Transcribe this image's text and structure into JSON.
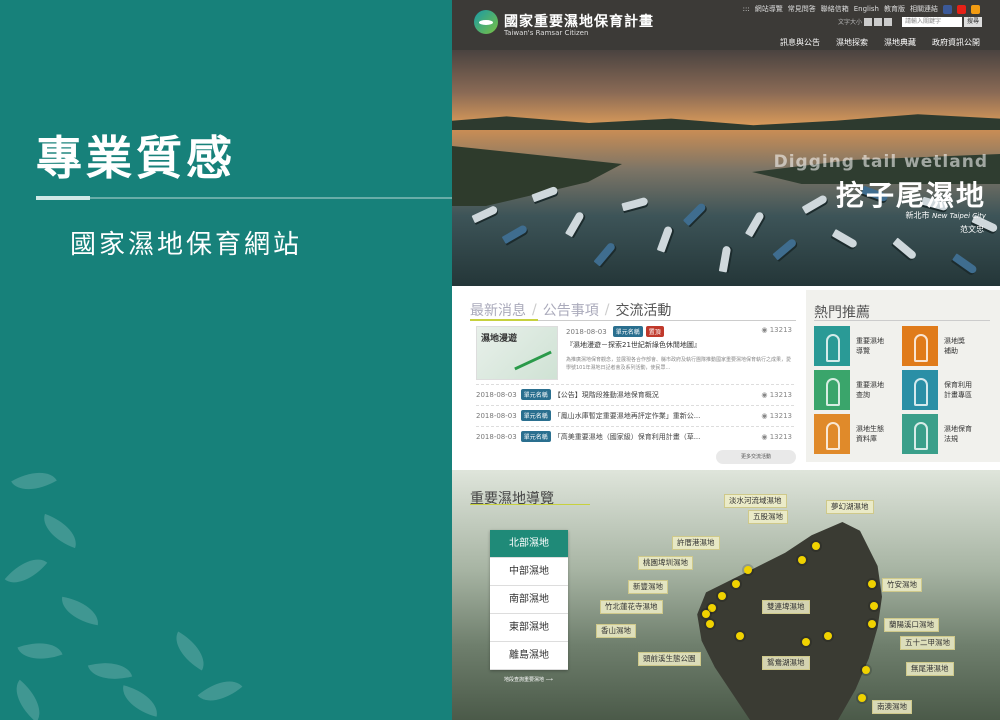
{
  "left": {
    "title": "專業質感",
    "subtitle": "國家濕地保育網站"
  },
  "header": {
    "site_title": "國家重要濕地保育計畫",
    "site_subtitle": "Taiwan's Ramsar Citizen",
    "util_links": [
      "::: ",
      "網站導覽",
      "常見問答",
      "聯絡信箱",
      "English",
      "教育版",
      "相關連結"
    ],
    "font_size_label": "文字大小",
    "font_size_options": [
      "小",
      "中",
      "大"
    ],
    "search_placeholder": "請輸入關鍵字",
    "search_button": "搜尋",
    "nav": [
      "訊息與公告",
      "濕地探索",
      "濕地典藏",
      "政府資訊公開"
    ]
  },
  "hero": {
    "en_title": "Digging tail wetland",
    "zh_title": "挖子尾濕地",
    "location_zh": "新北市",
    "location_en": "New Taipei City",
    "credit": "范文忠"
  },
  "news": {
    "tabs": [
      "最新消息",
      "公告事項",
      "交流活動"
    ],
    "featured": {
      "image_text": "濕地漫遊",
      "date": "2018-08-03",
      "tag1": "單元名稱",
      "tag2": "置頂",
      "views": "13213",
      "title": "『濕地漫遊－探索21世紀新綠色休閒地圖』",
      "desc": "為推廣濕地保育觀念，並展現各合作部會、縣市政府及執行團隊推動國家重要濕地保育執行之成果，愛學號101年濕地日記者會及系列活動，使民眾..."
    },
    "rows": [
      {
        "date": "2018-08-03",
        "tag": "單元名稱",
        "title": "【公告】現階段推動濕地保育概況",
        "views": "13213"
      },
      {
        "date": "2018-08-03",
        "tag": "單元名稱",
        "title": "「鳳山水庫暫定重要濕地再評定作業」重新公...",
        "views": "13213"
      },
      {
        "date": "2018-08-03",
        "tag": "單元名稱",
        "title": "「高美重要濕地（國家級）保育利用計畫（草...",
        "views": "13213"
      }
    ],
    "more_button": "更多交流活動"
  },
  "hot": {
    "title": "熱門推薦",
    "items": [
      {
        "label_line1": "重要濕地",
        "label_line2": "導覽",
        "color": "#2a9a96"
      },
      {
        "label_line1": "濕地獎",
        "label_line2": "補助",
        "color": "#e07b1a"
      },
      {
        "label_line1": "重要濕地",
        "label_line2": "查詢",
        "color": "#3aa56b"
      },
      {
        "label_line1": "保育利用",
        "label_line2": "計畫專區",
        "color": "#2a8fa6"
      },
      {
        "label_line1": "濕地生態",
        "label_line2": "資料庫",
        "color": "#e08a2a"
      },
      {
        "label_line1": "濕地保育",
        "label_line2": "法規",
        "color": "#3a9f8a"
      }
    ]
  },
  "map": {
    "title": "重要濕地導覽",
    "regions": [
      "北部濕地",
      "中部濕地",
      "南部濕地",
      "東部濕地",
      "離島濕地"
    ],
    "region_link": "地段查詢重要濕地",
    "wetlands": [
      "淡水河流域濕地",
      "五股濕地",
      "夢幻湖濕地",
      "許厝港濕地",
      "桃園埤圳濕地",
      "新豐濕地",
      "竹北蓮花寺濕地",
      "香山濕地",
      "雙連埤濕地",
      "竹安濕地",
      "蘭陽溪口濕地",
      "五十二甲濕地",
      "頭前溪生態公園",
      "鴛鴦湖濕地",
      "無尾港濕地",
      "南澳濕地"
    ]
  }
}
